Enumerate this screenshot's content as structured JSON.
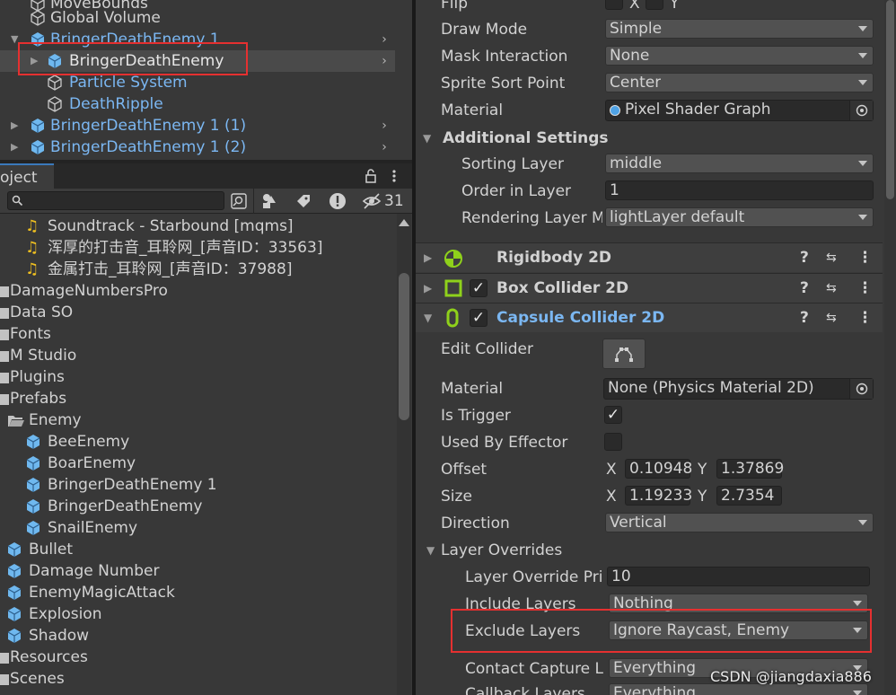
{
  "hierarchy": {
    "items": [
      {
        "label": "MoveBounds",
        "blue": false
      },
      {
        "label": "Global Volume",
        "blue": false
      },
      {
        "label": "BringerDeathEnemy 1",
        "blue": true
      },
      {
        "label": "BringerDeathEnemy",
        "blue": false
      },
      {
        "label": "Particle System",
        "blue": true
      },
      {
        "label": "DeathRipple",
        "blue": true
      },
      {
        "label": "BringerDeathEnemy 1 (1)",
        "blue": true
      },
      {
        "label": "BringerDeathEnemy 1 (2)",
        "blue": true
      }
    ]
  },
  "project": {
    "tab_label": "oject",
    "hidden_count": "31",
    "items": [
      "Soundtrack - Starbound [mqms]",
      "浑厚的打击音_耳聆网_[声音ID：33563]",
      "金属打击_耳聆网_[声音ID：37988]",
      "DamageNumbersPro",
      "Data SO",
      "Fonts",
      "M Studio",
      "Plugins",
      "Prefabs",
      "Enemy",
      "BeeEnemy",
      "BoarEnemy",
      "BringerDeathEnemy 1",
      "BringerDeathEnemy",
      "SnailEnemy",
      "Bullet",
      "Damage Number",
      "EnemyMagicAttack",
      "Explosion",
      "Shadow",
      "Resources",
      "Scenes"
    ]
  },
  "inspector": {
    "flip": {
      "label": "Flip",
      "x": "X",
      "y": "Y"
    },
    "draw_mode": {
      "label": "Draw Mode",
      "value": "Simple"
    },
    "mask_interaction": {
      "label": "Mask Interaction",
      "value": "None"
    },
    "sprite_sort_point": {
      "label": "Sprite Sort Point",
      "value": "Center"
    },
    "material": {
      "label": "Material",
      "value": "Pixel Shader Graph"
    },
    "additional_settings": "Additional Settings",
    "sorting_layer": {
      "label": "Sorting Layer",
      "value": "middle"
    },
    "order_in_layer": {
      "label": "Order in Layer",
      "value": "1"
    },
    "rendering_layer": {
      "label": "Rendering Layer M",
      "value": "lightLayer default"
    },
    "rigidbody": "Rigidbody 2D",
    "box_collider": "Box Collider 2D",
    "capsule_collider": "Capsule Collider 2D",
    "edit_collider": "Edit Collider",
    "phys_material": {
      "label": "Material",
      "value": "None (Physics Material 2D)"
    },
    "is_trigger": "Is Trigger",
    "used_by_effector": "Used By Effector",
    "offset": {
      "label": "Offset",
      "x_label": "X",
      "x": "0.10948",
      "y_label": "Y",
      "y": "1.37869"
    },
    "size": {
      "label": "Size",
      "x_label": "X",
      "x": "1.19233",
      "y_label": "Y",
      "y": "2.7354"
    },
    "direction": {
      "label": "Direction",
      "value": "Vertical"
    },
    "layer_overrides": "Layer Overrides",
    "layer_override_priority": {
      "label": "Layer Override Pri",
      "value": "10"
    },
    "include_layers": {
      "label": "Include Layers",
      "value": "Nothing"
    },
    "exclude_layers": {
      "label": "Exclude Layers",
      "value": "Ignore Raycast, Enemy"
    },
    "contact_capture": {
      "label": "Contact Capture L",
      "value": "Everything"
    },
    "callback_layers": {
      "label": "Callback Layers",
      "value": "Everything"
    }
  },
  "watermark": "CSDN @jiangdaxia886",
  "colors": {
    "accent_blue": "#7bb7f2",
    "highlight_red": "#e53030",
    "toggle_green": "#8fd11b"
  }
}
